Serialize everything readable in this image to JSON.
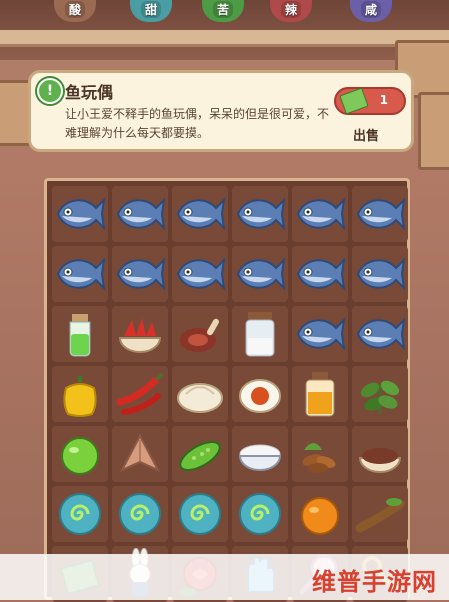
{
  "tabs": [
    {
      "label": "酸",
      "color": "#9b6a53"
    },
    {
      "label": "甜",
      "color": "#4a9ea3"
    },
    {
      "label": "苦",
      "color": "#4e9b45"
    },
    {
      "label": "辣",
      "color": "#b04a4a"
    },
    {
      "label": "咸",
      "color": "#6b5fa8"
    }
  ],
  "info": {
    "title": "鱼玩偶",
    "description": "让小王爱不释手的鱼玩偶，呆呆的但是很可爱，不难理解为什么每天都要摸。",
    "sell_count": "1",
    "sell_label": "出售"
  },
  "grid": [
    [
      "fish",
      "fish",
      "fish",
      "fish",
      "fish",
      "fish"
    ],
    [
      "fish",
      "fish",
      "fish",
      "fish",
      "fish",
      "fish"
    ],
    [
      "green-bottle",
      "chili-bowl",
      "ham",
      "glass-jar",
      "fish",
      "fish"
    ],
    [
      "yellow-pepper",
      "red-chilies",
      "bun",
      "salted-egg",
      "juice-jar",
      "herb"
    ],
    [
      "lime",
      "dried-fish",
      "bitter-melon",
      "rice",
      "nuts",
      "red-beans"
    ],
    [
      "spiral-bubble",
      "spiral-bubble",
      "spiral-bubble",
      "spiral-bubble",
      "orange",
      "tamarind"
    ],
    [
      "book",
      "rabbit-doll",
      "rose",
      "glove",
      "magnifier",
      "key"
    ]
  ],
  "watermark": "维普手游网"
}
